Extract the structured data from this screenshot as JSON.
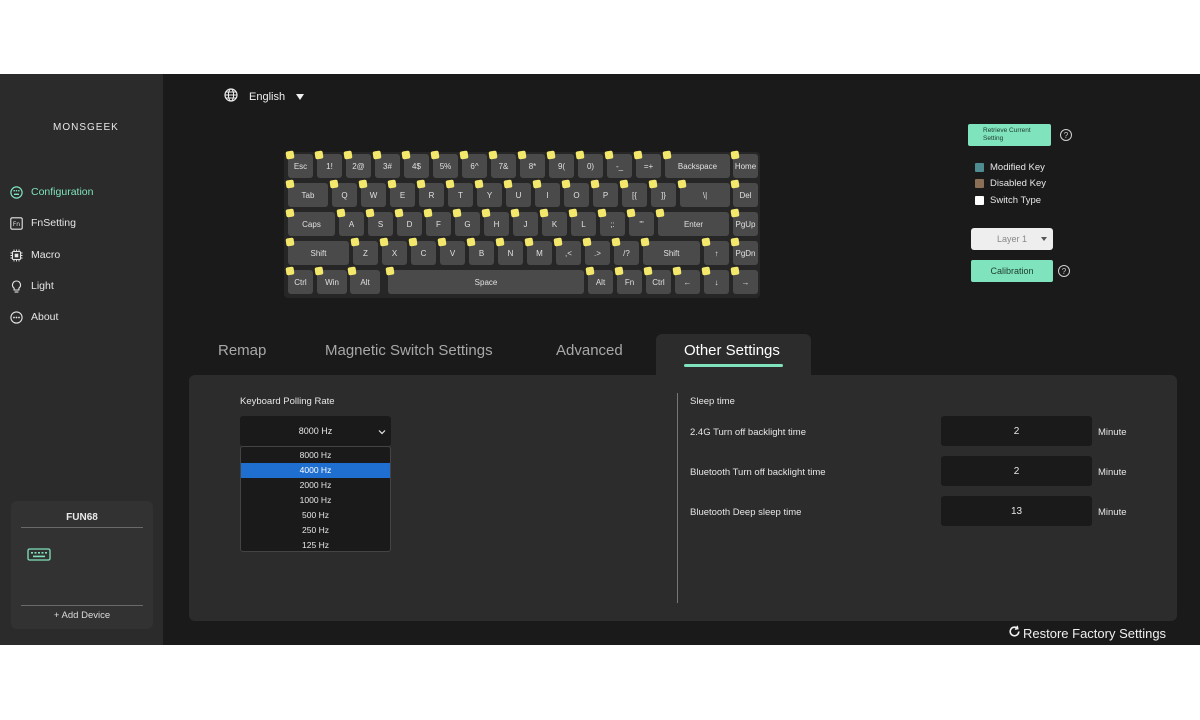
{
  "app": {
    "logo": "MONSGEEK"
  },
  "sidebar": {
    "items": [
      {
        "label": "Configuration",
        "icon": "keyboard-circle-icon"
      },
      {
        "label": "FnSetting",
        "icon": "fn-icon"
      },
      {
        "label": "Macro",
        "icon": "chip-icon"
      },
      {
        "label": "Light",
        "icon": "bulb-icon"
      },
      {
        "label": "About",
        "icon": "more-circle-icon"
      }
    ],
    "device": {
      "name": "FUN68",
      "add_label": "+ Add Device"
    }
  },
  "language": {
    "label": "English"
  },
  "keyboard": {
    "rows": [
      [
        "Esc",
        "1!",
        "2@",
        "3#",
        "4$",
        "5%",
        "6^",
        "7&",
        "8*",
        "9(",
        "0)",
        "-_",
        "=+",
        "Backspace",
        "Home"
      ],
      [
        "Tab",
        "Q",
        "W",
        "E",
        "R",
        "T",
        "Y",
        "U",
        "I",
        "O",
        "P",
        "[{",
        "]}",
        "\\|",
        "Del"
      ],
      [
        "Caps",
        "A",
        "S",
        "D",
        "F",
        "G",
        "H",
        "J",
        "K",
        "L",
        ";:",
        "'\"",
        "Enter",
        "PgUp"
      ],
      [
        "Shift",
        "Z",
        "X",
        "C",
        "V",
        "B",
        "N",
        "M",
        ",<",
        ".>",
        "/?",
        "Shift",
        "↑",
        "PgDn"
      ],
      [
        "Ctrl",
        "Win",
        "Alt",
        "Space",
        "Alt",
        "Fn",
        "Ctrl",
        "←",
        "↓",
        "→"
      ]
    ]
  },
  "right_panel": {
    "retrieve_label": "Retrieve Current Setting",
    "legend": [
      {
        "label": "Modified Key",
        "color": "#4f8c92"
      },
      {
        "label": "Disabled Key",
        "color": "#8a6e55"
      },
      {
        "label": "Switch Type",
        "color": "#ffffff"
      }
    ],
    "layer": "Layer 1",
    "calibration_label": "Calibration"
  },
  "tabs": [
    {
      "label": "Remap"
    },
    {
      "label": "Magnetic Switch Settings"
    },
    {
      "label": "Advanced"
    },
    {
      "label": "Other Settings"
    }
  ],
  "polling": {
    "label": "Keyboard Polling Rate",
    "value": "8000 Hz",
    "options": [
      "8000 Hz",
      "4000 Hz",
      "2000 Hz",
      "1000 Hz",
      "500 Hz",
      "250 Hz",
      "125 Hz"
    ],
    "highlighted": "4000 Hz"
  },
  "sleep": {
    "title": "Sleep time",
    "rows": [
      {
        "label": "2.4G Turn off backlight time",
        "value": "2",
        "unit": "Minute"
      },
      {
        "label": "Bluetooth Turn off backlight time",
        "value": "2",
        "unit": "Minute"
      },
      {
        "label": "Bluetooth Deep sleep time",
        "value": "13",
        "unit": "Minute"
      }
    ]
  },
  "restore_label": "Restore Factory Settings",
  "colors": {
    "accent": "#7fe3bd",
    "keycap_mark": "#f3e86b",
    "dropdown_highlight": "#1e6fd0"
  }
}
